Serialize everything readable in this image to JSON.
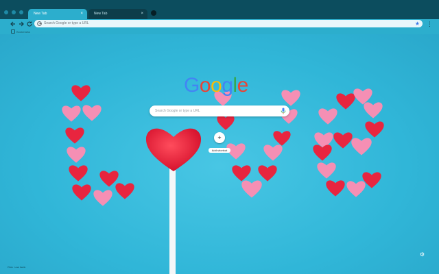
{
  "browser": {
    "tabs": [
      {
        "title": "New Tab",
        "active": true
      },
      {
        "title": "New Tab",
        "active": false
      }
    ],
    "tab_close_glyph": "×",
    "omnibox": {
      "placeholder": "Search Google or type a URL"
    },
    "bookmarks": [
      {
        "label": "Bookmarks"
      }
    ]
  },
  "ntp": {
    "logo_letters": [
      {
        "char": "G",
        "color": "#4285F4"
      },
      {
        "char": "o",
        "color": "#EA4335"
      },
      {
        "char": "o",
        "color": "#FBBC05"
      },
      {
        "char": "g",
        "color": "#4285F4"
      },
      {
        "char": "l",
        "color": "#34A853"
      },
      {
        "char": "e",
        "color": "#EA4335"
      }
    ],
    "search": {
      "placeholder": "Search Google or type a URL"
    },
    "shortcut": {
      "glyph": "+",
      "label": "Add shortcut"
    },
    "footer": "Photo · Love hearts"
  },
  "icons": [
    "back-arrow-icon",
    "forward-arrow-icon",
    "reload-icon",
    "google-g-icon",
    "star-icon",
    "menu-icon",
    "mic-icon",
    "gear-icon"
  ],
  "colors": {
    "tab_active": "#2caecd",
    "frame": "#0c4d5e",
    "page_bg": "#30b2d2",
    "heart_red": "#e8253f",
    "heart_pink": "#f58fb4"
  }
}
